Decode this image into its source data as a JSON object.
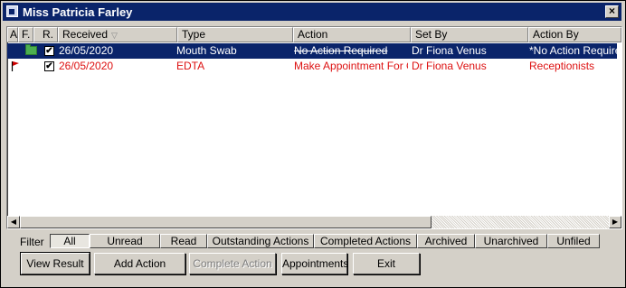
{
  "window": {
    "title": "Miss Patricia Farley",
    "close_label": "×"
  },
  "list": {
    "columns": [
      "A.",
      "F.",
      "R.",
      "Received",
      "Type",
      "Action",
      "Set By",
      "Action By"
    ],
    "rows": [
      {
        "received": "26/05/2020",
        "type": "Mouth Swab",
        "action": "No Action Required",
        "set_by": "Dr Fiona Venus",
        "action_by": "*No Action Required",
        "selected": true
      },
      {
        "received": "26/05/2020",
        "type": "EDTA",
        "action": "Make Appointment For Gp",
        "set_by": "Dr Fiona Venus",
        "action_by": "Receptionists",
        "selected": false
      }
    ]
  },
  "filter": {
    "label": "Filter",
    "tabs": [
      "All",
      "Unread",
      "Read",
      "Outstanding Actions",
      "Completed Actions",
      "Archived",
      "Unarchived",
      "Unfiled"
    ],
    "active": "All"
  },
  "buttons": {
    "view_result": "View Result",
    "add_action": "Add Action",
    "complete_action": "Complete Action",
    "appointments": "Appointments",
    "exit": "Exit"
  },
  "icons": {
    "sort": "▽",
    "check": "✔",
    "scroll_left": "◀",
    "scroll_right": "▶"
  },
  "colors": {
    "title_bar": "#0a246a",
    "selection": "#0a246a",
    "urgent_text": "#dd1111"
  }
}
